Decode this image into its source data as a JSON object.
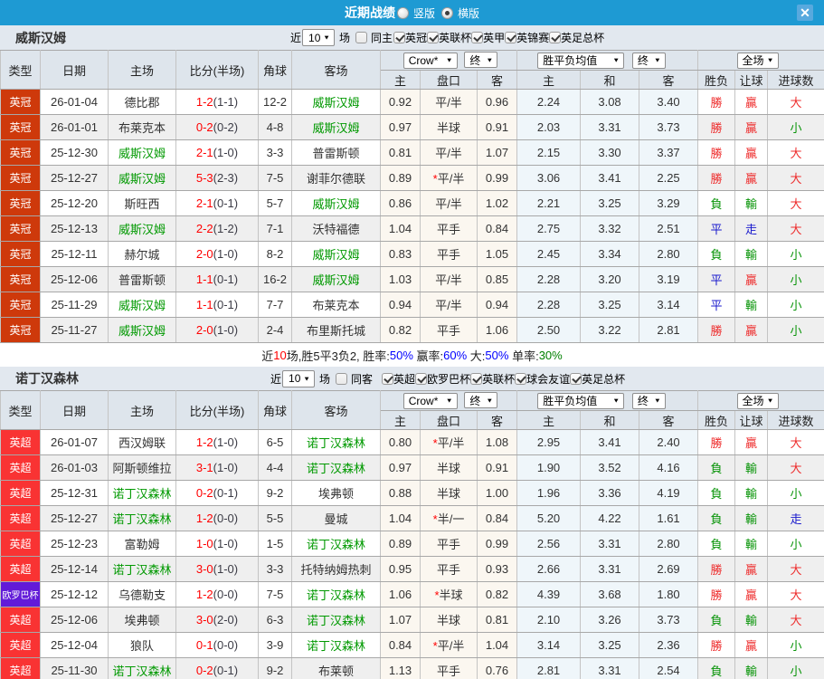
{
  "colors": {
    "titlebar_bg": "#1E9AD3",
    "close_button_bg": "#58A9DE",
    "section_header_bg": "#DEE5EC",
    "row_alt_bg": "#EFEFEF",
    "odds_cell_bg": "#FBF7F0",
    "mean_cell_bg": "#EFF6FA",
    "league_yingguan": "#CE390B",
    "league_yingchao": "#F93333",
    "league_oulouba": "#621AD8",
    "team_highlight_green": "#009900",
    "score_red": "#FF0000",
    "win_red": "#EE2D2D",
    "lose_green": "#089408",
    "draw_blue": "#1919CD",
    "summary_blue": "#0000FF",
    "summary_green": "#008000"
  },
  "titlebar": {
    "title": "近期战绩",
    "radios": [
      {
        "label": "竖版",
        "selected": false
      },
      {
        "label": "横版",
        "selected": true
      }
    ],
    "close_icon": "✕"
  },
  "table_header": {
    "type": "类型",
    "date": "日期",
    "home": "主场",
    "score": "比分(半场)",
    "corner": "角球",
    "away": "客场",
    "odds_home": "主",
    "odds_handicap": "盘口",
    "odds_away": "客",
    "mean_home": "主",
    "mean_draw": "和",
    "mean_away": "客",
    "result": "胜负",
    "handicap_result": "让球",
    "goals": "进球数",
    "select_company": "Crow*",
    "select_final_1": "终",
    "select_mean": "胜平负均值",
    "select_final_2": "终",
    "select_scope": "全场",
    "dropdown_arrow": "▼"
  },
  "filter_common": {
    "prefix": "近",
    "suffix": "场"
  },
  "tables": [
    {
      "team": "威斯汉姆",
      "matches": "10",
      "same_filter": "同主",
      "leagues": [
        "英冠",
        "英联杯",
        "英甲",
        "英锦赛",
        "英足总杯"
      ],
      "rows": [
        {
          "league": "英冠",
          "league_key": "yingguan",
          "date": "26-01-04",
          "home": "德比郡",
          "home_hl": false,
          "score": "1-2",
          "half": "(1-1)",
          "corner": "12-2",
          "away": "威斯汉姆",
          "away_hl": true,
          "odds_home": "0.92",
          "handicap_star": "",
          "handicap": "平/半",
          "odds_away": "0.96",
          "mean_home": "2.24",
          "mean_draw": "3.08",
          "mean_away": "3.40",
          "result": "勝",
          "result_c": "red",
          "hres": "贏",
          "hres_c": "red",
          "goals": "大",
          "goals_c": "red"
        },
        {
          "league": "英冠",
          "league_key": "yingguan",
          "date": "26-01-01",
          "home": "布莱克本",
          "home_hl": false,
          "score": "0-2",
          "half": "(0-2)",
          "corner": "4-8",
          "away": "威斯汉姆",
          "away_hl": true,
          "odds_home": "0.97",
          "handicap_star": "",
          "handicap": "半球",
          "odds_away": "0.91",
          "mean_home": "2.03",
          "mean_draw": "3.31",
          "mean_away": "3.73",
          "result": "勝",
          "result_c": "red",
          "hres": "贏",
          "hres_c": "red",
          "goals": "小",
          "goals_c": "green"
        },
        {
          "league": "英冠",
          "league_key": "yingguan",
          "date": "25-12-30",
          "home": "威斯汉姆",
          "home_hl": true,
          "score": "2-1",
          "half": "(1-0)",
          "corner": "3-3",
          "away": "普雷斯顿",
          "away_hl": false,
          "odds_home": "0.81",
          "handicap_star": "",
          "handicap": "平/半",
          "odds_away": "1.07",
          "mean_home": "2.15",
          "mean_draw": "3.30",
          "mean_away": "3.37",
          "result": "勝",
          "result_c": "red",
          "hres": "贏",
          "hres_c": "red",
          "goals": "大",
          "goals_c": "red"
        },
        {
          "league": "英冠",
          "league_key": "yingguan",
          "date": "25-12-27",
          "home": "威斯汉姆",
          "home_hl": true,
          "score": "5-3",
          "half": "(2-3)",
          "corner": "7-5",
          "away": "谢菲尔德联",
          "away_hl": false,
          "odds_home": "0.89",
          "handicap_star": "*",
          "handicap": "平/半",
          "odds_away": "0.99",
          "mean_home": "3.06",
          "mean_draw": "3.41",
          "mean_away": "2.25",
          "result": "勝",
          "result_c": "red",
          "hres": "贏",
          "hres_c": "red",
          "goals": "大",
          "goals_c": "red"
        },
        {
          "league": "英冠",
          "league_key": "yingguan",
          "date": "25-12-20",
          "home": "斯旺西",
          "home_hl": false,
          "score": "2-1",
          "half": "(0-1)",
          "corner": "5-7",
          "away": "威斯汉姆",
          "away_hl": true,
          "odds_home": "0.86",
          "handicap_star": "",
          "handicap": "平/半",
          "odds_away": "1.02",
          "mean_home": "2.21",
          "mean_draw": "3.25",
          "mean_away": "3.29",
          "result": "負",
          "result_c": "green",
          "hres": "輸",
          "hres_c": "green",
          "goals": "大",
          "goals_c": "red"
        },
        {
          "league": "英冠",
          "league_key": "yingguan",
          "date": "25-12-13",
          "home": "威斯汉姆",
          "home_hl": true,
          "score": "2-2",
          "half": "(1-2)",
          "corner": "7-1",
          "away": "沃特福德",
          "away_hl": false,
          "odds_home": "1.04",
          "handicap_star": "",
          "handicap": "平手",
          "odds_away": "0.84",
          "mean_home": "2.75",
          "mean_draw": "3.32",
          "mean_away": "2.51",
          "result": "平",
          "result_c": "blue",
          "hres": "走",
          "hres_c": "blue",
          "goals": "大",
          "goals_c": "red"
        },
        {
          "league": "英冠",
          "league_key": "yingguan",
          "date": "25-12-11",
          "home": "赫尔城",
          "home_hl": false,
          "score": "2-0",
          "half": "(1-0)",
          "corner": "8-2",
          "away": "威斯汉姆",
          "away_hl": true,
          "odds_home": "0.83",
          "handicap_star": "",
          "handicap": "平手",
          "odds_away": "1.05",
          "mean_home": "2.45",
          "mean_draw": "3.34",
          "mean_away": "2.80",
          "result": "負",
          "result_c": "green",
          "hres": "輸",
          "hres_c": "green",
          "goals": "小",
          "goals_c": "green"
        },
        {
          "league": "英冠",
          "league_key": "yingguan",
          "date": "25-12-06",
          "home": "普雷斯顿",
          "home_hl": false,
          "score": "1-1",
          "half": "(0-1)",
          "corner": "16-2",
          "away": "威斯汉姆",
          "away_hl": true,
          "odds_home": "1.03",
          "handicap_star": "",
          "handicap": "平/半",
          "odds_away": "0.85",
          "mean_home": "2.28",
          "mean_draw": "3.20",
          "mean_away": "3.19",
          "result": "平",
          "result_c": "blue",
          "hres": "贏",
          "hres_c": "red",
          "goals": "小",
          "goals_c": "green"
        },
        {
          "league": "英冠",
          "league_key": "yingguan",
          "date": "25-11-29",
          "home": "威斯汉姆",
          "home_hl": true,
          "score": "1-1",
          "half": "(0-1)",
          "corner": "7-7",
          "away": "布莱克本",
          "away_hl": false,
          "odds_home": "0.94",
          "handicap_star": "",
          "handicap": "平/半",
          "odds_away": "0.94",
          "mean_home": "2.28",
          "mean_draw": "3.25",
          "mean_away": "3.14",
          "result": "平",
          "result_c": "blue",
          "hres": "輸",
          "hres_c": "green",
          "goals": "小",
          "goals_c": "green"
        },
        {
          "league": "英冠",
          "league_key": "yingguan",
          "date": "25-11-27",
          "home": "威斯汉姆",
          "home_hl": true,
          "score": "2-0",
          "half": "(1-0)",
          "corner": "2-4",
          "away": "布里斯托城",
          "away_hl": false,
          "odds_home": "0.82",
          "handicap_star": "",
          "handicap": "平手",
          "odds_away": "1.06",
          "mean_home": "2.50",
          "mean_draw": "3.22",
          "mean_away": "2.81",
          "result": "勝",
          "result_c": "red",
          "hres": "贏",
          "hres_c": "red",
          "goals": "小",
          "goals_c": "green"
        }
      ],
      "summary": [
        {
          "text": "近",
          "color": "black"
        },
        {
          "text": "10",
          "color": "red"
        },
        {
          "text": "场,胜5平3负2, 胜率:",
          "color": "black"
        },
        {
          "text": "50%",
          "color": "blue"
        },
        {
          "text": " 赢率:",
          "color": "black"
        },
        {
          "text": "60%",
          "color": "blue"
        },
        {
          "text": " 大:",
          "color": "black"
        },
        {
          "text": "50%",
          "color": "blue"
        },
        {
          "text": " 单率:",
          "color": "black"
        },
        {
          "text": "30%",
          "color": "green"
        }
      ]
    },
    {
      "team": "诺丁汉森林",
      "matches": "10",
      "same_filter": "同客",
      "leagues": [
        "英超",
        "欧罗巴杯",
        "英联杯",
        "球会友谊",
        "英足总杯"
      ],
      "rows": [
        {
          "league": "英超",
          "league_key": "yingchao",
          "date": "26-01-07",
          "home": "西汉姆联",
          "home_hl": false,
          "score": "1-2",
          "half": "(1-0)",
          "corner": "6-5",
          "away": "诺丁汉森林",
          "away_hl": true,
          "odds_home": "0.80",
          "handicap_star": "*",
          "handicap": "平/半",
          "odds_away": "1.08",
          "mean_home": "2.95",
          "mean_draw": "3.41",
          "mean_away": "2.40",
          "result": "勝",
          "result_c": "red",
          "hres": "贏",
          "hres_c": "red",
          "goals": "大",
          "goals_c": "red"
        },
        {
          "league": "英超",
          "league_key": "yingchao",
          "date": "26-01-03",
          "home": "阿斯顿维拉",
          "home_hl": false,
          "score": "3-1",
          "half": "(1-0)",
          "corner": "4-4",
          "away": "诺丁汉森林",
          "away_hl": true,
          "odds_home": "0.97",
          "handicap_star": "",
          "handicap": "半球",
          "odds_away": "0.91",
          "mean_home": "1.90",
          "mean_draw": "3.52",
          "mean_away": "4.16",
          "result": "負",
          "result_c": "green",
          "hres": "輸",
          "hres_c": "green",
          "goals": "大",
          "goals_c": "red"
        },
        {
          "league": "英超",
          "league_key": "yingchao",
          "date": "25-12-31",
          "home": "诺丁汉森林",
          "home_hl": true,
          "score": "0-2",
          "half": "(0-1)",
          "corner": "9-2",
          "away": "埃弗顿",
          "away_hl": false,
          "odds_home": "0.88",
          "handicap_star": "",
          "handicap": "半球",
          "odds_away": "1.00",
          "mean_home": "1.96",
          "mean_draw": "3.36",
          "mean_away": "4.19",
          "result": "負",
          "result_c": "green",
          "hres": "輸",
          "hres_c": "green",
          "goals": "小",
          "goals_c": "green"
        },
        {
          "league": "英超",
          "league_key": "yingchao",
          "date": "25-12-27",
          "home": "诺丁汉森林",
          "home_hl": true,
          "score": "1-2",
          "half": "(0-0)",
          "corner": "5-5",
          "away": "曼城",
          "away_hl": false,
          "odds_home": "1.04",
          "handicap_star": "*",
          "handicap": "半/一",
          "odds_away": "0.84",
          "mean_home": "5.20",
          "mean_draw": "4.22",
          "mean_away": "1.61",
          "result": "負",
          "result_c": "green",
          "hres": "輸",
          "hres_c": "green",
          "goals": "走",
          "goals_c": "blue"
        },
        {
          "league": "英超",
          "league_key": "yingchao",
          "date": "25-12-23",
          "home": "富勒姆",
          "home_hl": false,
          "score": "1-0",
          "half": "(1-0)",
          "corner": "1-5",
          "away": "诺丁汉森林",
          "away_hl": true,
          "odds_home": "0.89",
          "handicap_star": "",
          "handicap": "平手",
          "odds_away": "0.99",
          "mean_home": "2.56",
          "mean_draw": "3.31",
          "mean_away": "2.80",
          "result": "負",
          "result_c": "green",
          "hres": "輸",
          "hres_c": "green",
          "goals": "小",
          "goals_c": "green"
        },
        {
          "league": "英超",
          "league_key": "yingchao",
          "date": "25-12-14",
          "home": "诺丁汉森林",
          "home_hl": true,
          "score": "3-0",
          "half": "(1-0)",
          "corner": "3-3",
          "away": "托特纳姆热刺",
          "away_hl": false,
          "odds_home": "0.95",
          "handicap_star": "",
          "handicap": "平手",
          "odds_away": "0.93",
          "mean_home": "2.66",
          "mean_draw": "3.31",
          "mean_away": "2.69",
          "result": "勝",
          "result_c": "red",
          "hres": "贏",
          "hres_c": "red",
          "goals": "大",
          "goals_c": "red"
        },
        {
          "league": "欧罗巴杯",
          "league_key": "oulouba",
          "date": "25-12-12",
          "home": "乌德勒支",
          "home_hl": false,
          "score": "1-2",
          "half": "(0-0)",
          "corner": "7-5",
          "away": "诺丁汉森林",
          "away_hl": true,
          "odds_home": "1.06",
          "handicap_star": "*",
          "handicap": "半球",
          "odds_away": "0.82",
          "mean_home": "4.39",
          "mean_draw": "3.68",
          "mean_away": "1.80",
          "result": "勝",
          "result_c": "red",
          "hres": "贏",
          "hres_c": "red",
          "goals": "大",
          "goals_c": "red"
        },
        {
          "league": "英超",
          "league_key": "yingchao",
          "date": "25-12-06",
          "home": "埃弗顿",
          "home_hl": false,
          "score": "3-0",
          "half": "(2-0)",
          "corner": "6-3",
          "away": "诺丁汉森林",
          "away_hl": true,
          "odds_home": "1.07",
          "handicap_star": "",
          "handicap": "半球",
          "odds_away": "0.81",
          "mean_home": "2.10",
          "mean_draw": "3.26",
          "mean_away": "3.73",
          "result": "負",
          "result_c": "green",
          "hres": "輸",
          "hres_c": "green",
          "goals": "大",
          "goals_c": "red"
        },
        {
          "league": "英超",
          "league_key": "yingchao",
          "date": "25-12-04",
          "home": "狼队",
          "home_hl": false,
          "score": "0-1",
          "half": "(0-0)",
          "corner": "3-9",
          "away": "诺丁汉森林",
          "away_hl": true,
          "odds_home": "0.84",
          "handicap_star": "*",
          "handicap": "平/半",
          "odds_away": "1.04",
          "mean_home": "3.14",
          "mean_draw": "3.25",
          "mean_away": "2.36",
          "result": "勝",
          "result_c": "red",
          "hres": "贏",
          "hres_c": "red",
          "goals": "小",
          "goals_c": "green"
        },
        {
          "league": "英超",
          "league_key": "yingchao",
          "date": "25-11-30",
          "home": "诺丁汉森林",
          "home_hl": true,
          "score": "0-2",
          "half": "(0-1)",
          "corner": "9-2",
          "away": "布莱顿",
          "away_hl": false,
          "odds_home": "1.13",
          "handicap_star": "",
          "handicap": "平手",
          "odds_away": "0.76",
          "mean_home": "2.81",
          "mean_draw": "3.31",
          "mean_away": "2.54",
          "result": "負",
          "result_c": "green",
          "hres": "輸",
          "hres_c": "green",
          "goals": "小",
          "goals_c": "green"
        }
      ],
      "summary": []
    }
  ]
}
